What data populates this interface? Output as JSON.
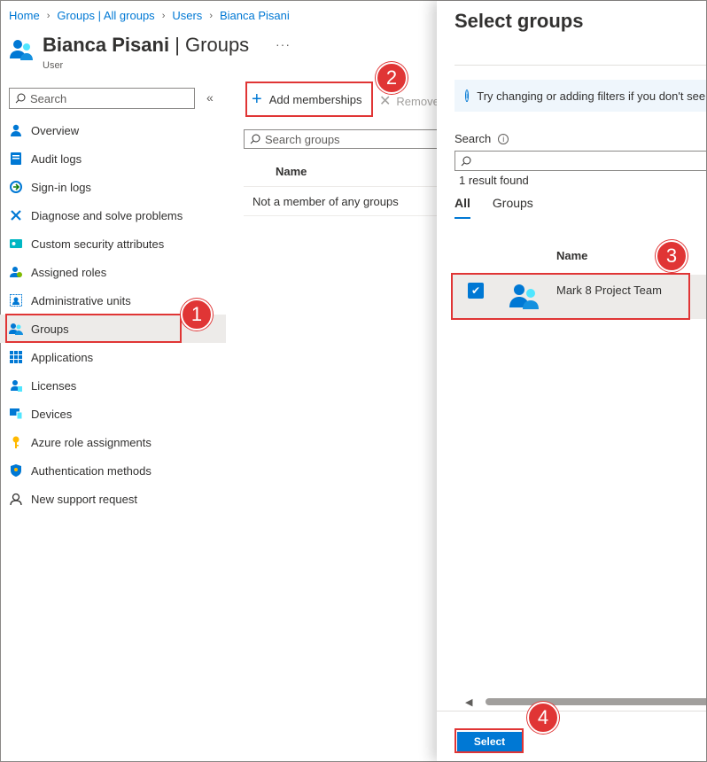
{
  "breadcrumb": [
    "Home",
    "Groups | All groups",
    "Users",
    "Bianca Pisani"
  ],
  "page": {
    "title_name": "Bianca Pisani",
    "title_section": "Groups",
    "subtitle": "User",
    "ellipsis": "···"
  },
  "sidebar": {
    "search_placeholder": "Search",
    "collapse_glyph": "«",
    "items": [
      {
        "label": "Overview",
        "icon": "user-icon"
      },
      {
        "label": "Audit logs",
        "icon": "audit-log-icon"
      },
      {
        "label": "Sign-in logs",
        "icon": "sign-in-icon"
      },
      {
        "label": "Diagnose and solve problems",
        "icon": "wrench-icon"
      },
      {
        "label": "Custom security attributes",
        "icon": "security-attributes-icon"
      },
      {
        "label": "Assigned roles",
        "icon": "assigned-roles-icon"
      },
      {
        "label": "Administrative units",
        "icon": "admin-units-icon"
      },
      {
        "label": "Groups",
        "icon": "groups-icon"
      },
      {
        "label": "Applications",
        "icon": "apps-grid-icon"
      },
      {
        "label": "Licenses",
        "icon": "licenses-icon"
      },
      {
        "label": "Devices",
        "icon": "devices-icon"
      },
      {
        "label": "Azure role assignments",
        "icon": "key-icon"
      },
      {
        "label": "Authentication methods",
        "icon": "shield-icon"
      },
      {
        "label": "New support request",
        "icon": "support-person-icon"
      }
    ]
  },
  "main": {
    "add_label": "Add memberships",
    "remove_label": "Remove",
    "search_placeholder": "Search groups",
    "column_name": "Name",
    "empty_message": "Not a member of any groups"
  },
  "panel": {
    "title": "Select groups",
    "info_text": "Try changing or adding filters if you don't see what you're looking for.",
    "search_label": "Search",
    "search_value": "",
    "result_count": "1 result found",
    "tabs": [
      "All",
      "Groups"
    ],
    "column_name": "Name",
    "row_name": "Mark 8 Project Team",
    "select_label": "Select"
  },
  "annotations": [
    "1",
    "2",
    "3",
    "4"
  ],
  "colors": {
    "accent": "#0078d4",
    "annotation": "#e03535"
  }
}
